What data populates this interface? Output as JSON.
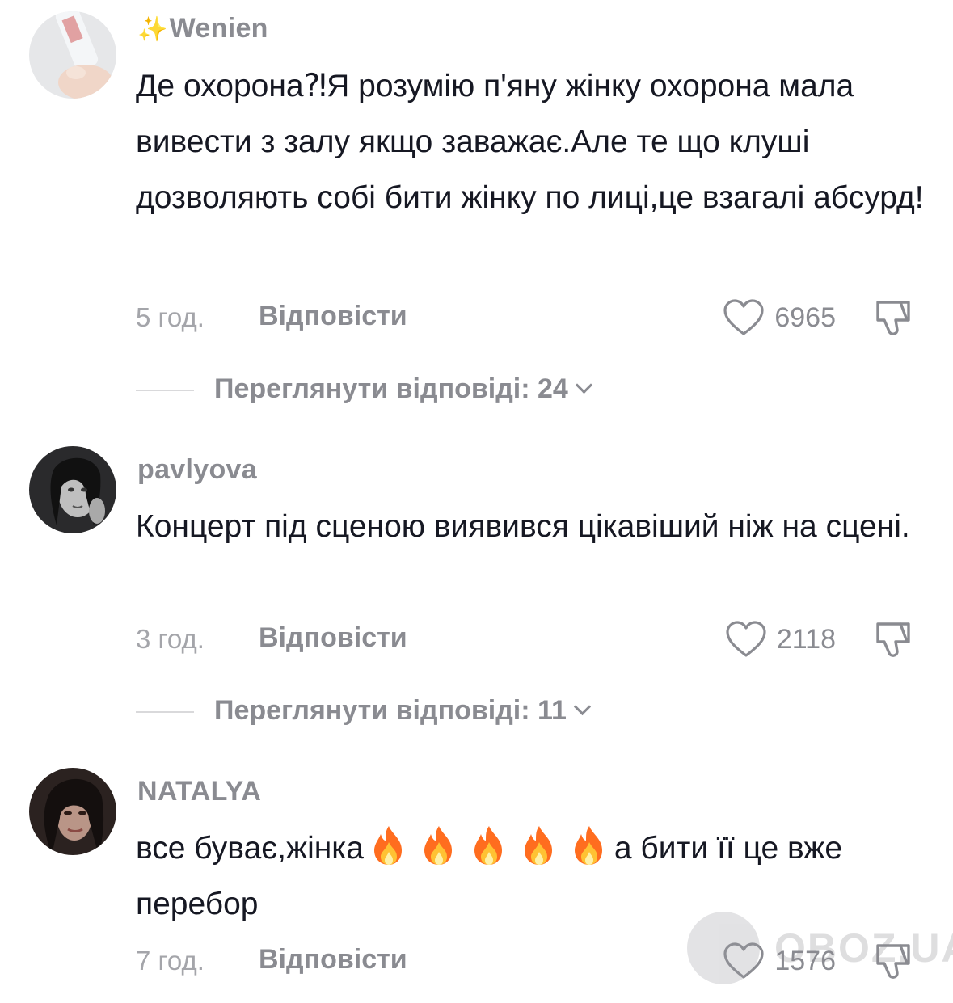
{
  "comments": [
    {
      "username": "Wenien",
      "username_prefix_icon": "sparkles-emoji",
      "text": "Де охорона⁈Я розумію п'яну жінку охорона мала вивести з залу якщо заважає.Але те що клуші дозволяють собі бити жінку по лиці,це взагалі абсурд!",
      "time": "5 год.",
      "reply_label": "Відповісти",
      "likes": "6965",
      "view_replies": "Переглянути відповіді: 24"
    },
    {
      "username": "pavlyova",
      "text": "Концерт під сценою виявився цікавіший ніж на сцені.",
      "time": "3 год.",
      "reply_label": "Відповісти",
      "likes": "2118",
      "view_replies": "Переглянути відповіді: 11"
    },
    {
      "username": "NATALYA",
      "text_before": "все буває,жінка",
      "text_emoji": "fire-emoji",
      "text_emoji_count": 5,
      "text_after": "а бити її це вже перебор",
      "time": "7 год.",
      "reply_label": "Відповісти",
      "likes": "1576"
    }
  ],
  "watermark": "OBOZ.UA",
  "colors": {
    "text": "#161823",
    "secondary": "#8a8b91",
    "time": "#a4a5aa",
    "divider": "#d9d9db"
  }
}
